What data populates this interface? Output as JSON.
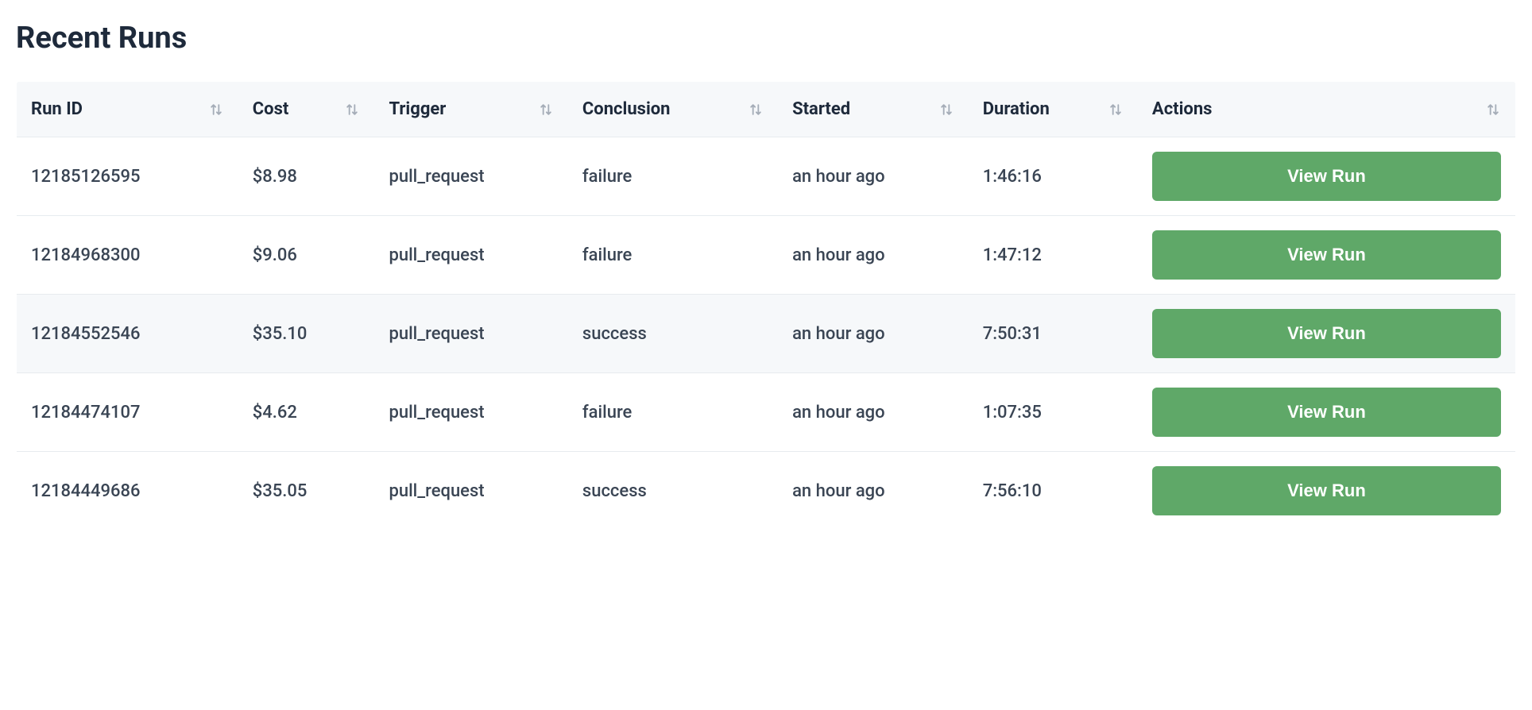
{
  "title": "Recent Runs",
  "columns": {
    "run_id": "Run ID",
    "cost": "Cost",
    "trigger": "Trigger",
    "conclusion": "Conclusion",
    "started": "Started",
    "duration": "Duration",
    "actions": "Actions"
  },
  "view_run_label": "View Run",
  "rows": [
    {
      "run_id": "12185126595",
      "cost": "$8.98",
      "trigger": "pull_request",
      "conclusion": "failure",
      "started": "an hour ago",
      "duration": "1:46:16"
    },
    {
      "run_id": "12184968300",
      "cost": "$9.06",
      "trigger": "pull_request",
      "conclusion": "failure",
      "started": "an hour ago",
      "duration": "1:47:12"
    },
    {
      "run_id": "12184552546",
      "cost": "$35.10",
      "trigger": "pull_request",
      "conclusion": "success",
      "started": "an hour ago",
      "duration": "7:50:31"
    },
    {
      "run_id": "12184474107",
      "cost": "$4.62",
      "trigger": "pull_request",
      "conclusion": "failure",
      "started": "an hour ago",
      "duration": "1:07:35"
    },
    {
      "run_id": "12184449686",
      "cost": "$35.05",
      "trigger": "pull_request",
      "conclusion": "success",
      "started": "an hour ago",
      "duration": "7:56:10"
    }
  ]
}
